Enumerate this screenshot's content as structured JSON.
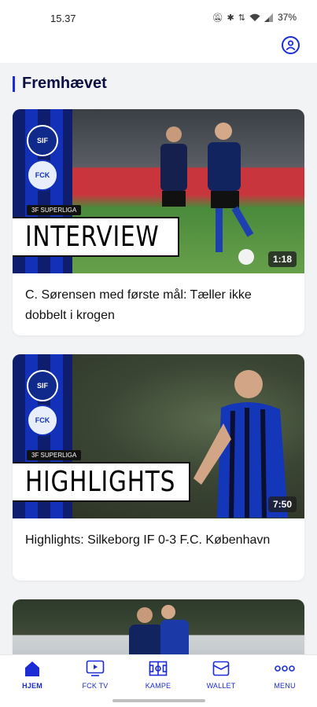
{
  "status": {
    "time": "15.37",
    "battery": "37%",
    "icons": [
      "mute-icon",
      "bluetooth-icon",
      "data-icon",
      "wifi-icon",
      "signal-icon"
    ]
  },
  "section": {
    "title": "Fremhævet"
  },
  "cards": [
    {
      "badge_top": "SIF",
      "badge_bottom": "FCK",
      "league": "3F SUPERLIGA",
      "label": "INTERVIEW",
      "duration": "1:18",
      "title": "C. Sørensen med første mål: Tæller ikke dobbelt i krogen"
    },
    {
      "badge_top": "SIF",
      "badge_bottom": "FCK",
      "league": "3F SUPERLIGA",
      "label": "HIGHLIGHTS",
      "duration": "7:50",
      "title": "Highlights: Silkeborg IF 0-3 F.C. København"
    }
  ],
  "nav": [
    {
      "label": "HJEM",
      "icon": "home-icon",
      "active": true
    },
    {
      "label": "FCK TV",
      "icon": "tv-icon",
      "active": false
    },
    {
      "label": "KAMPE",
      "icon": "pitch-icon",
      "active": false
    },
    {
      "label": "WALLET",
      "icon": "wallet-icon",
      "active": false
    },
    {
      "label": "MENU",
      "icon": "more-icon",
      "active": false
    }
  ],
  "colors": {
    "accent": "#1b2bd6",
    "title": "#0b1042",
    "background": "#f2f3f5"
  }
}
